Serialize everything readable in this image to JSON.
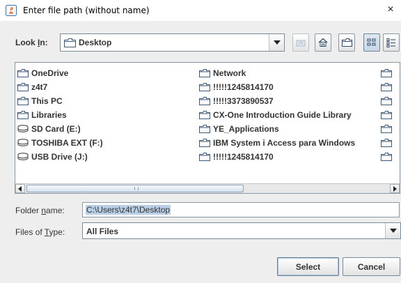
{
  "window": {
    "title": "Enter file path (without name)",
    "close_glyph": "×"
  },
  "lookin": {
    "label_prefix": "Look ",
    "label_mnemonic": "I",
    "label_suffix": "n:",
    "value": "Desktop"
  },
  "toolbar": [
    "up-folder-icon",
    "home-icon",
    "new-folder-icon",
    "list-view-icon",
    "details-view-icon"
  ],
  "files": {
    "column1": [
      {
        "name": "OneDrive",
        "icon": "folder"
      },
      {
        "name": "z4t7",
        "icon": "folder"
      },
      {
        "name": "This PC",
        "icon": "folder"
      },
      {
        "name": "Libraries",
        "icon": "folder"
      },
      {
        "name": "SD Card (E:)",
        "icon": "drive"
      },
      {
        "name": "TOSHIBA EXT (F:)",
        "icon": "drive"
      },
      {
        "name": "USB Drive (J:)",
        "icon": "drive"
      }
    ],
    "column2": [
      {
        "name": "Network",
        "icon": "folder"
      },
      {
        "name": "!!!!!1245814170",
        "icon": "folder"
      },
      {
        "name": "!!!!!3373890537",
        "icon": "folder"
      },
      {
        "name": "CX-One Introduction Guide Library",
        "icon": "folder"
      },
      {
        "name": "YE_Applications",
        "icon": "folder"
      },
      {
        "name": "IBM System i Access para Windows",
        "icon": "folder"
      },
      {
        "name": "!!!!!1245814170",
        "icon": "folder"
      }
    ]
  },
  "folder_name": {
    "label_prefix": "Folder ",
    "label_mnemonic": "n",
    "label_suffix": "ame:",
    "value": "C:\\Users\\z4t7\\Desktop"
  },
  "files_of_type": {
    "label_prefix": "Files of ",
    "label_mnemonic": "T",
    "label_suffix": "ype:",
    "value": "All Files"
  },
  "buttons": {
    "select": "Select",
    "cancel": "Cancel"
  }
}
